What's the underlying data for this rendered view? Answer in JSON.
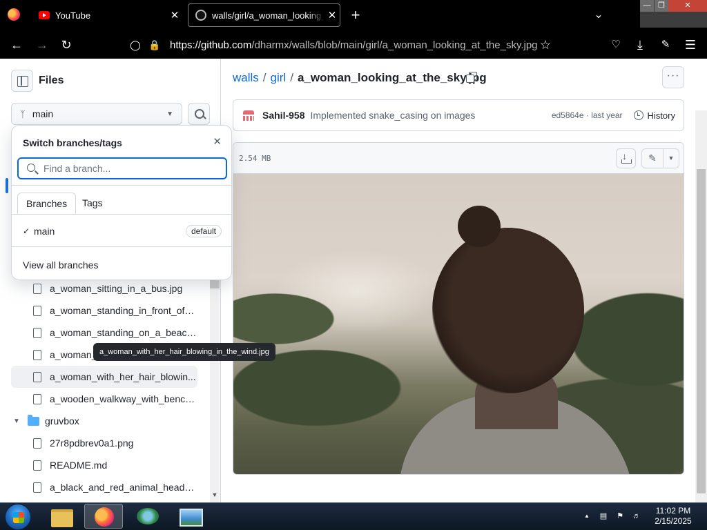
{
  "browser": {
    "tabs": [
      {
        "title": "YouTube",
        "close": "✕"
      },
      {
        "title": "walls/girl/a_woman_looking_at_the_sky.jpg",
        "close": "✕"
      }
    ],
    "new_tab": "+",
    "url_host": "https://github.com",
    "url_path": "/dharmx/walls/blob/main/girl/a_woman_looking_at_the_sky.jpg"
  },
  "sidebar": {
    "title": "Files",
    "branch": "main",
    "tree": [
      {
        "kind": "file",
        "label": "a_woman_sitting_in_a_bus.jpg"
      },
      {
        "kind": "file",
        "label": "a_woman_standing_in_front_of_..."
      },
      {
        "kind": "file",
        "label": "a_woman_standing_on_a_beach..."
      },
      {
        "kind": "file",
        "label": "a_woman_..."
      },
      {
        "kind": "file",
        "label": "a_woman_with_her_hair_blowin...",
        "selected": true
      },
      {
        "kind": "file",
        "label": "a_wooden_walkway_with_bench..."
      },
      {
        "kind": "folder",
        "label": "gruvbox"
      },
      {
        "kind": "file",
        "label": "27r8pdbrev0a1.png"
      },
      {
        "kind": "file",
        "label": "README.md"
      },
      {
        "kind": "file",
        "label": "a_black_and_red_animal_head_w..."
      }
    ]
  },
  "branch_popover": {
    "title": "Switch branches/tags",
    "search_placeholder": "Find a branch...",
    "tabs": [
      "Branches",
      "Tags"
    ],
    "branches": [
      {
        "name": "main",
        "badge": "default",
        "check": "✓"
      }
    ],
    "view_all": "View all branches",
    "close": "✕"
  },
  "tooltip": "a_woman_with_her_hair_blowing_in_the_wind.jpg",
  "main": {
    "breadcrumb": {
      "repo": "walls",
      "sep1": "/",
      "folder": "girl",
      "sep2": "/",
      "file": "a_woman_looking_at_the_sky.jpg"
    },
    "more": "···",
    "commit": {
      "author": "Sahil-958",
      "message": "Implemented snake_casing on images",
      "meta": "ed5864e · last year",
      "history": "History"
    },
    "file": {
      "size": "2.54 MB"
    }
  },
  "taskbar": {
    "time": "11:02 PM",
    "date": "2/15/2025",
    "tray_up": "▲"
  },
  "colors": {
    "accent": "#0969da",
    "border": "#d0d7de",
    "chrome": "#000000"
  }
}
